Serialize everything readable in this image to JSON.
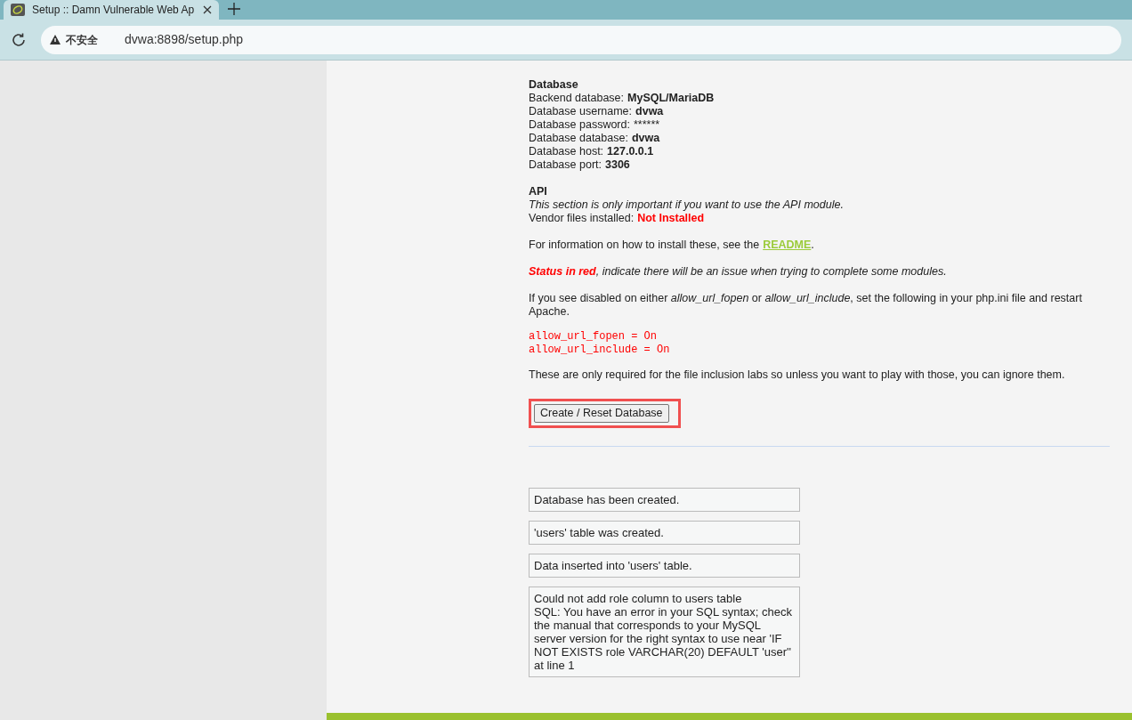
{
  "browser": {
    "tab_title": "Setup :: Damn Vulnerable Web Ap",
    "security_label": "不安全",
    "url": "dvwa:8898/setup.php"
  },
  "database": {
    "heading": "Database",
    "rows": [
      {
        "label": "Backend database:",
        "value": "MySQL/MariaDB",
        "kind": "bold"
      },
      {
        "label": "Database username:",
        "value": "dvwa",
        "kind": "bold"
      },
      {
        "label": "Database password:",
        "value": "******",
        "kind": "plain"
      },
      {
        "label": "Database database:",
        "value": "dvwa",
        "kind": "bold"
      },
      {
        "label": "Database host:",
        "value": "127.0.0.1",
        "kind": "bold"
      },
      {
        "label": "Database port:",
        "value": "3306",
        "kind": "bold"
      }
    ]
  },
  "api": {
    "heading": "API",
    "note": "This section is only important if you want to use the API module.",
    "vendor_label": "Vendor files installed:",
    "vendor_value": "Not Installed"
  },
  "readme_text": "For information on how to install these, see the",
  "readme_link": "README",
  "readme_end": ".",
  "status_red": "Status in red",
  "status_rest": ", indicate there will be an issue when trying to complete some modules.",
  "config_text": "If you see disabled on either *allow_url_fopen* or *allow_url_include*, set the following in your php.ini file and restart Apache.",
  "config_lines": [
    "allow_url_fopen = On",
    "allow_url_include = On"
  ],
  "inclusion_note": "These are only required for the file inclusion labs so unless you want to play with those, you can ignore them.",
  "button": {
    "label": "Create / Reset Database",
    "highlighted": true
  },
  "messages": [
    [
      "Database has been created."
    ],
    [
      "'users' table was created."
    ],
    [
      "Data inserted into 'users' table."
    ],
    [
      "Could not add role column to users table",
      "SQL: You have an error in your SQL syntax; check the manual that corresponds to your MySQL server version for the right syntax to use near 'IF NOT EXISTS role VARCHAR(20) DEFAULT 'user'' at line 1"
    ]
  ]
}
